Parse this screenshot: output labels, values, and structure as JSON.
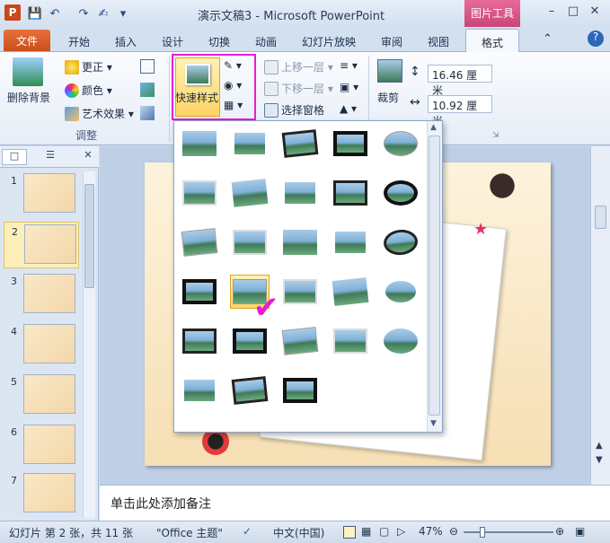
{
  "window": {
    "title": "演示文稿3 - Microsoft PowerPoint",
    "tool_tab_title": "图片工具",
    "app_icon_letter": "P"
  },
  "tabs": {
    "file": "文件",
    "items": [
      "开始",
      "插入",
      "设计",
      "切换",
      "动画",
      "幻灯片放映",
      "审阅",
      "视图"
    ],
    "active": "格式"
  },
  "ribbon": {
    "remove_background": "删除背景",
    "corrections": "更正",
    "color": "颜色",
    "artistic_effects": "艺术效果",
    "adjust_group": "调整",
    "quick_styles": "快速样式",
    "bring_forward": "上移一层",
    "send_backward": "下移一层",
    "selection_pane": "选择窗格",
    "crop": "裁剪",
    "height": "16.46 厘米",
    "width": "10.92 厘米"
  },
  "thumbnails": {
    "numbers": [
      "1",
      "2",
      "3",
      "4",
      "5",
      "6",
      "7"
    ],
    "selected_index": 1
  },
  "gallery": {
    "rows": 6,
    "columns": 5,
    "item_count": 28,
    "selected_index": 16
  },
  "notes": {
    "placeholder": "单击此处添加备注"
  },
  "status": {
    "slide_info": "幻灯片 第 2 张，共 11 张",
    "theme": "\"Office 主题\"",
    "language": "中文(中国)",
    "zoom": "47%"
  },
  "colors": {
    "file_tab": "#c94f1c",
    "tool_tab": "#d24f83",
    "highlight": "#e61ed2",
    "check_mark": "#e61ed2"
  }
}
